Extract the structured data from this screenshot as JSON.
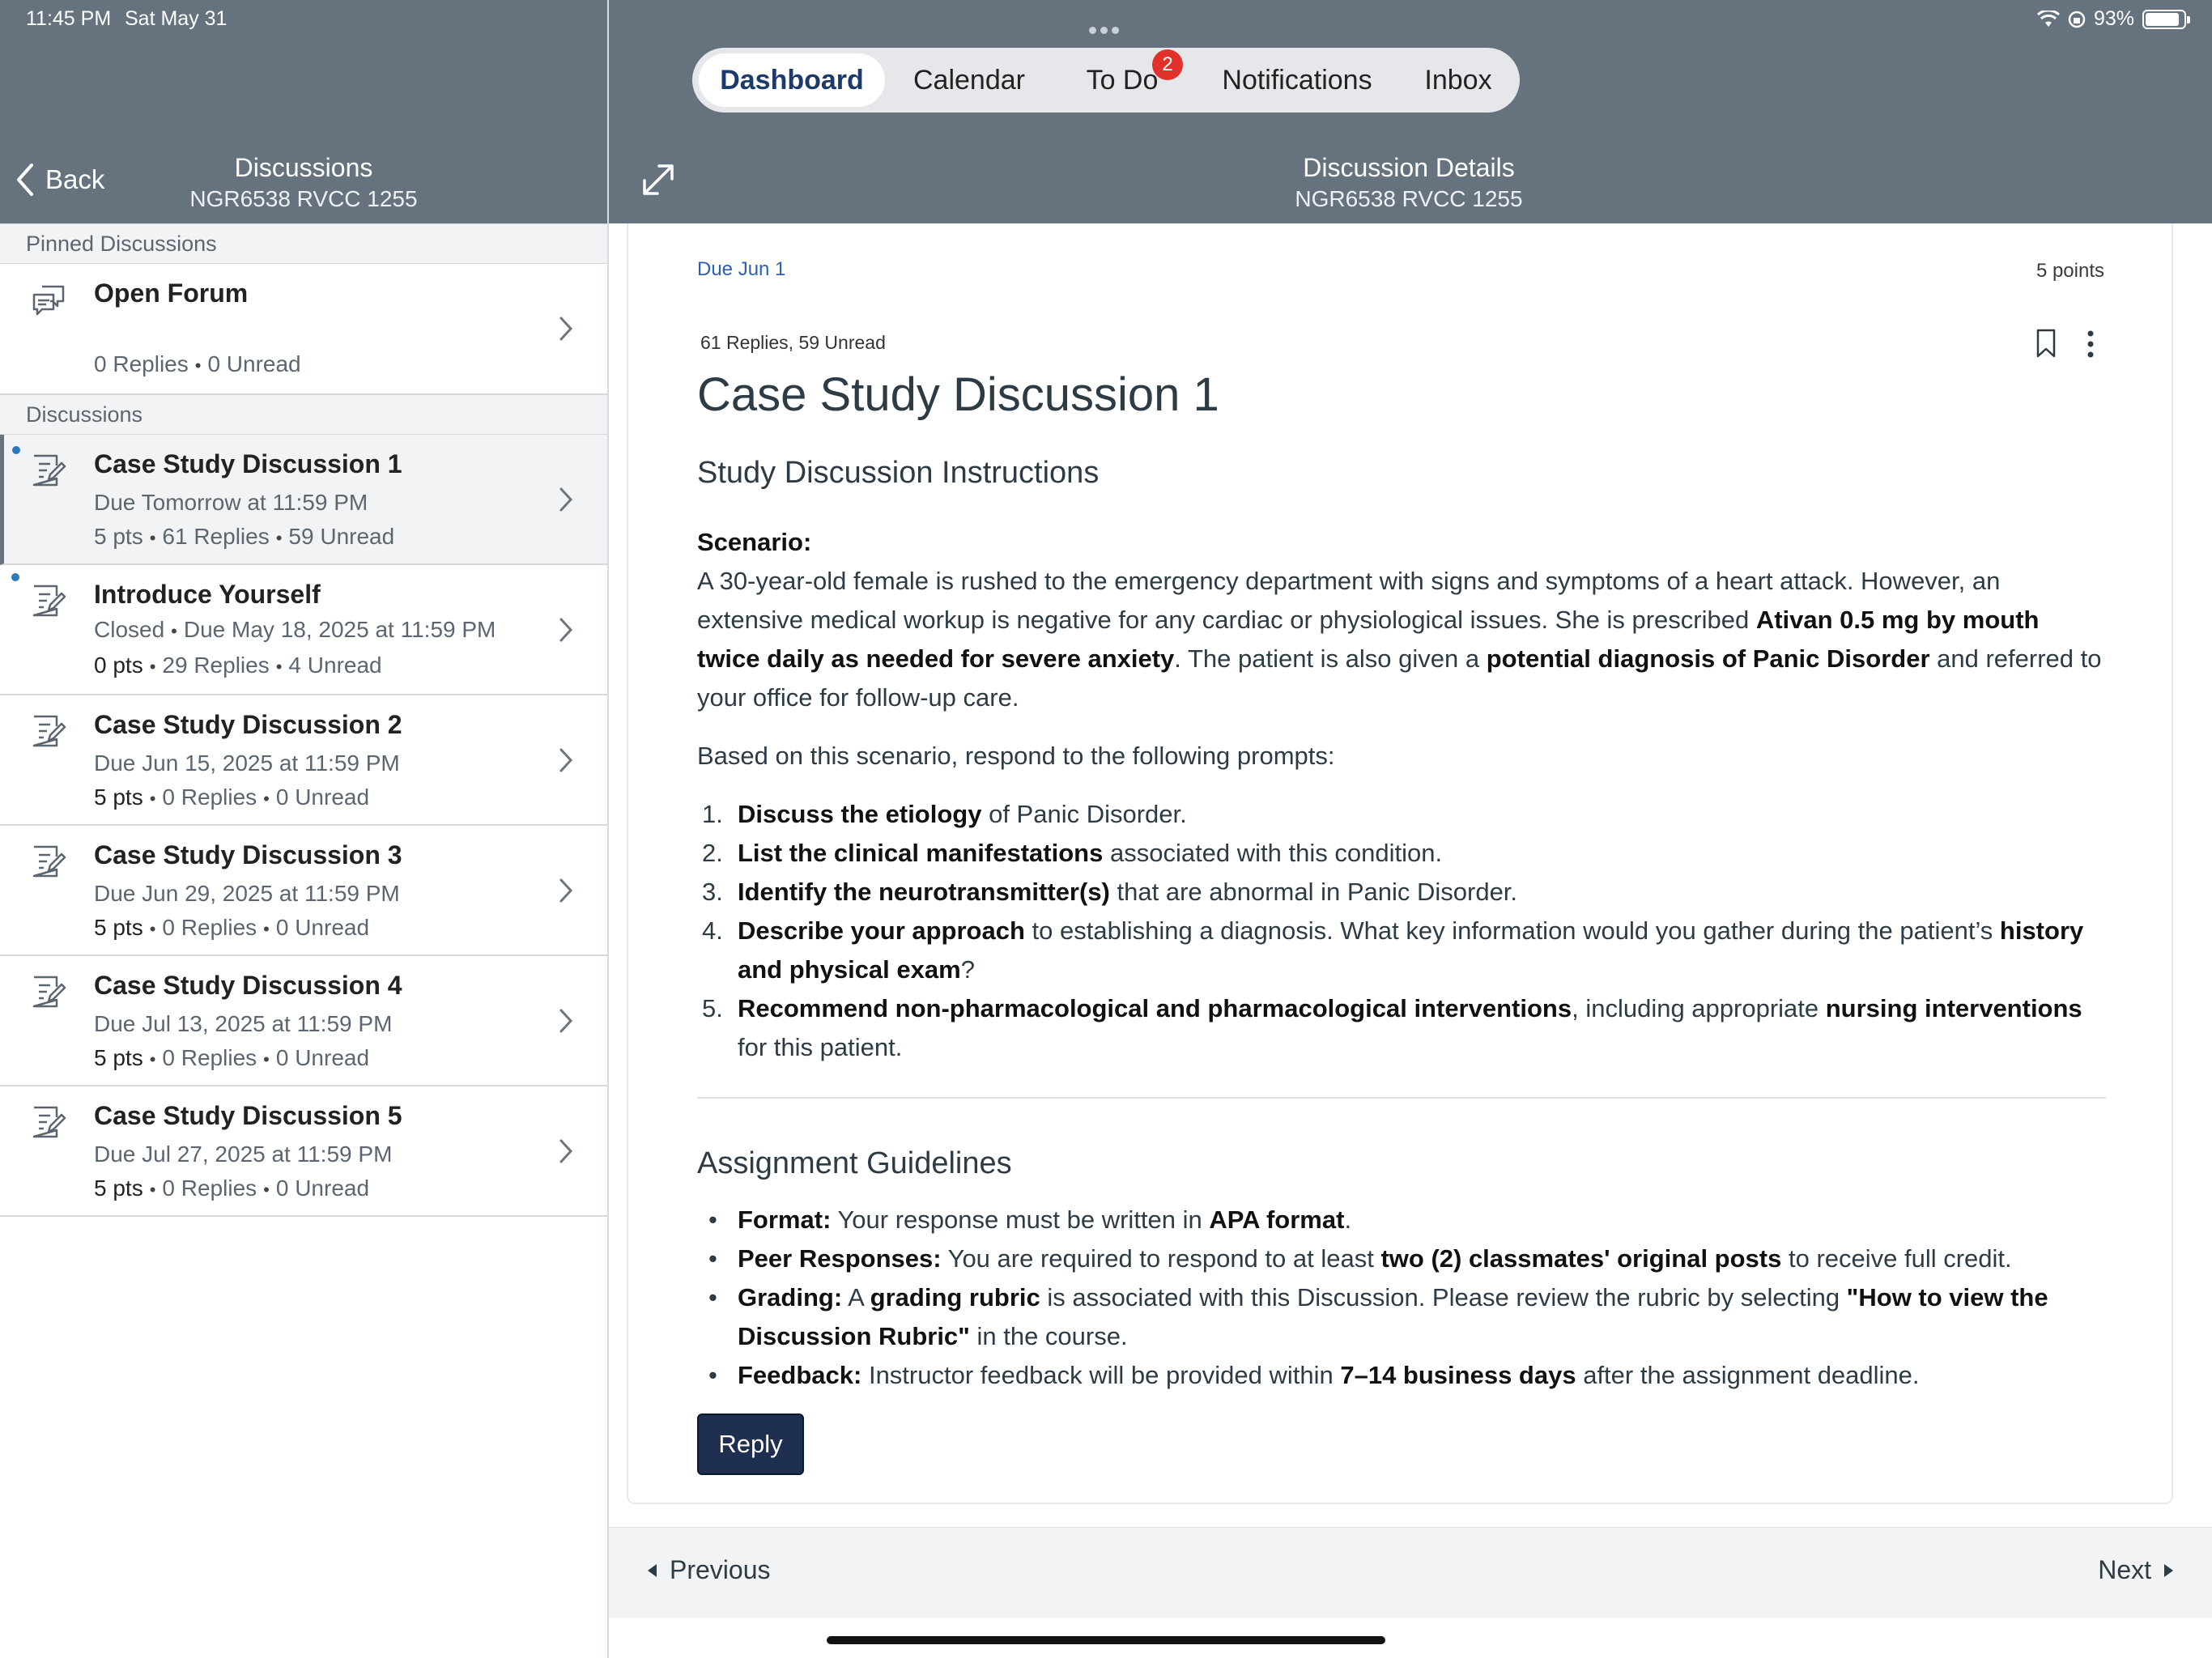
{
  "status_bar": {
    "time": "11:45 PM",
    "date": "Sat May 31",
    "battery": "93%"
  },
  "left_header": {
    "back_label": "Back",
    "title": "Discussions",
    "subtitle": "NGR6538 RVCC 1255"
  },
  "top_nav": {
    "tabs": [
      "Dashboard",
      "Calendar",
      "To Do",
      "Notifications",
      "Inbox"
    ],
    "active": "Dashboard",
    "todo_badge": "2"
  },
  "right_header": {
    "title": "Discussion Details",
    "subtitle": "NGR6538 RVCC 1255"
  },
  "sections": {
    "pinned": "Pinned Discussions",
    "discussions": "Discussions"
  },
  "pinned_items": [
    {
      "title": "Open Forum",
      "replies": "0 Replies",
      "unread": "0 Unread"
    }
  ],
  "discussion_items": [
    {
      "title": "Case Study Discussion 1",
      "due": "Due Tomorrow at 11:59 PM",
      "pts": "5 pts",
      "replies": "61 Replies",
      "unread": "59 Unread",
      "selected": true,
      "has_unread_dot": true
    },
    {
      "title": "Introduce Yourself",
      "status": "Closed",
      "due": "Due May 18, 2025 at 11:59 PM",
      "pts": "0 pts",
      "replies": "29 Replies",
      "unread": "4 Unread",
      "has_unread_dot": true
    },
    {
      "title": "Case Study Discussion 2",
      "due": "Due Jun 15, 2025 at 11:59 PM",
      "pts": "5 pts",
      "replies": "0 Replies",
      "unread": "0 Unread"
    },
    {
      "title": "Case Study Discussion 3",
      "due": "Due Jun 29, 2025 at 11:59 PM",
      "pts": "5 pts",
      "replies": "0 Replies",
      "unread": "0 Unread"
    },
    {
      "title": "Case Study Discussion 4",
      "due": "Due Jul 13, 2025 at 11:59 PM",
      "pts": "5 pts",
      "replies": "0 Replies",
      "unread": "0 Unread"
    },
    {
      "title": "Case Study Discussion 5",
      "due": "Due Jul 27, 2025 at 11:59 PM",
      "pts": "5 pts",
      "replies": "0 Replies",
      "unread": "0 Unread"
    }
  ],
  "detail": {
    "due": "Due Jun 1",
    "points": "5 points",
    "replies_summary": "61 Replies, 59 Unread",
    "title": "Case Study Discussion 1",
    "subheading": "Study Discussion Instructions",
    "scenario_label": "Scenario:",
    "scenario_parts": [
      "A 30-year-old female is rushed to the emergency department with signs and symptoms of a heart attack. However, an extensive medical workup is negative for any cardiac or physiological issues. She is prescribed ",
      "Ativan 0.5 mg by mouth twice daily as needed for severe anxiety",
      ". The patient is also given a ",
      "potential diagnosis of Panic Disorder",
      " and referred to your office for follow-up care."
    ],
    "prompt_intro": "Based on this scenario, respond to the following prompts:",
    "prompts": [
      {
        "n": "1.",
        "b1": "Discuss the etiology",
        "t1": " of Panic Disorder."
      },
      {
        "n": "2.",
        "b1": "List the clinical manifestations",
        "t1": " associated with this condition."
      },
      {
        "n": "3.",
        "b1": "Identify the neurotransmitter(s)",
        "t1": " that are abnormal in Panic Disorder."
      },
      {
        "n": "4.",
        "b1": "Describe your approach",
        "t1": " to establishing a diagnosis. What key information would you gather during the patient’s ",
        "b2": "history and physical exam",
        "t2": "?"
      },
      {
        "n": "5.",
        "b1": "Recommend non-pharmacological and pharmacological interventions",
        "t1": ", including appropriate ",
        "b2": "nursing interventions",
        "t2": " for this patient."
      }
    ],
    "guidelines_heading": "Assignment Guidelines",
    "guidelines": [
      {
        "b1": "Format:",
        "t1": " Your response must be written in ",
        "b2": "APA format",
        "t2": "."
      },
      {
        "b1": "Peer Responses:",
        "t1": " You are required to respond to at least ",
        "b2": "two (2) classmates' original posts",
        "t2": " to receive full credit."
      },
      {
        "b1": "Grading:",
        "t1": " A ",
        "b2": "grading rubric",
        "t2": " is associated with this Discussion. Please review the rubric by selecting ",
        "b3": "\"How to view the Discussion Rubric\"",
        "t3": " in the course."
      },
      {
        "b1": "Feedback:",
        "t1": " Instructor feedback will be provided within ",
        "b2": "7–14 business days",
        "t2": " after the assignment deadline."
      }
    ],
    "reply_label": "Reply"
  },
  "bottom_nav": {
    "previous": "Previous",
    "next": "Next"
  }
}
